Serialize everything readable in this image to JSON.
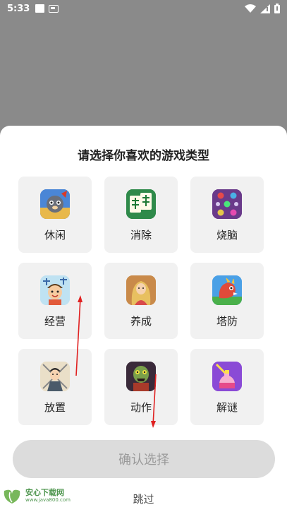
{
  "status_bar": {
    "time": "5:33"
  },
  "sheet": {
    "title": "请选择你喜欢的游戏类型",
    "categories": [
      {
        "label": "休闲",
        "icon": "raccoon-game-icon"
      },
      {
        "label": "消除",
        "icon": "mahjong-tile-icon"
      },
      {
        "label": "烧脑",
        "icon": "dots-puzzle-icon"
      },
      {
        "label": "经营",
        "icon": "boy-character-icon"
      },
      {
        "label": "养成",
        "icon": "girl-character-icon"
      },
      {
        "label": "塔防",
        "icon": "dragon-icon"
      },
      {
        "label": "放置",
        "icon": "warrior-character-icon"
      },
      {
        "label": "动作",
        "icon": "zombie-icon"
      },
      {
        "label": "解谜",
        "icon": "bottle-puzzle-icon"
      }
    ],
    "confirm_label": "确认选择",
    "skip_label": "跳过"
  },
  "watermark": {
    "brand": "安心下载网",
    "url": "www.java800.com"
  },
  "colors": {
    "dim_background": "#8a8a8a",
    "tile_background": "#f1f1f1",
    "button_disabled": "#dcdcdc",
    "annotation_arrow": "#e02020"
  }
}
